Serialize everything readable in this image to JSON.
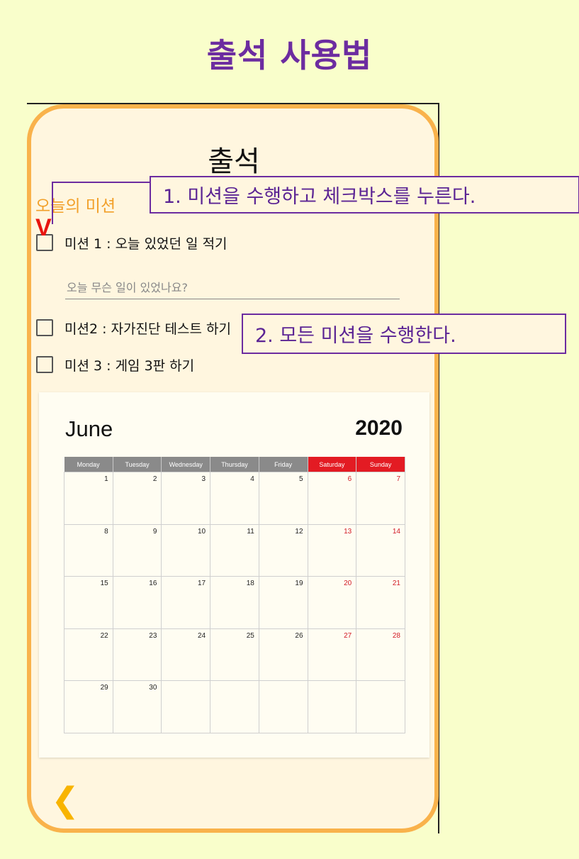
{
  "heading": "출석 사용법",
  "app": {
    "title": "출석",
    "mission_heading": "오늘의 미션",
    "check_mark": "V",
    "missions": [
      {
        "label": "미션 1 : 오늘 있었던 일 적기",
        "checked": false
      },
      {
        "label": "미션2 : 자가진단 테스트 하기",
        "checked": false
      },
      {
        "label": "미션 3 : 게임 3판 하기",
        "checked": false
      }
    ],
    "answer_placeholder": "오늘 무슨 일이 있었나요?",
    "answer_value": "",
    "back_icon": "chevron-left-icon"
  },
  "callouts": {
    "step1": "1. 미션을 수행하고 체크박스를 누른다.",
    "step2": "2. 모든 미션을 수행한다."
  },
  "calendar": {
    "month": "June",
    "year": "2020",
    "weekdays": [
      "Monday",
      "Tuesday",
      "Wednesday",
      "Thursday",
      "Friday",
      "Saturday",
      "Sunday"
    ],
    "weeks": [
      [
        "1",
        "2",
        "3",
        "4",
        "5",
        "6",
        "7"
      ],
      [
        "8",
        "9",
        "10",
        "11",
        "12",
        "13",
        "14"
      ],
      [
        "15",
        "16",
        "17",
        "18",
        "19",
        "20",
        "21"
      ],
      [
        "22",
        "23",
        "24",
        "25",
        "26",
        "27",
        "28"
      ],
      [
        "29",
        "30",
        "",
        "",
        "",
        "",
        ""
      ]
    ]
  },
  "colors": {
    "background": "#f9fecb",
    "heading": "#6c2ca0",
    "frame": "#f9b24b",
    "mission_heading": "#f2a02a",
    "check_mark": "#e8140f",
    "weekend": "#e31b23",
    "weekday_header": "#8a8a8a"
  }
}
